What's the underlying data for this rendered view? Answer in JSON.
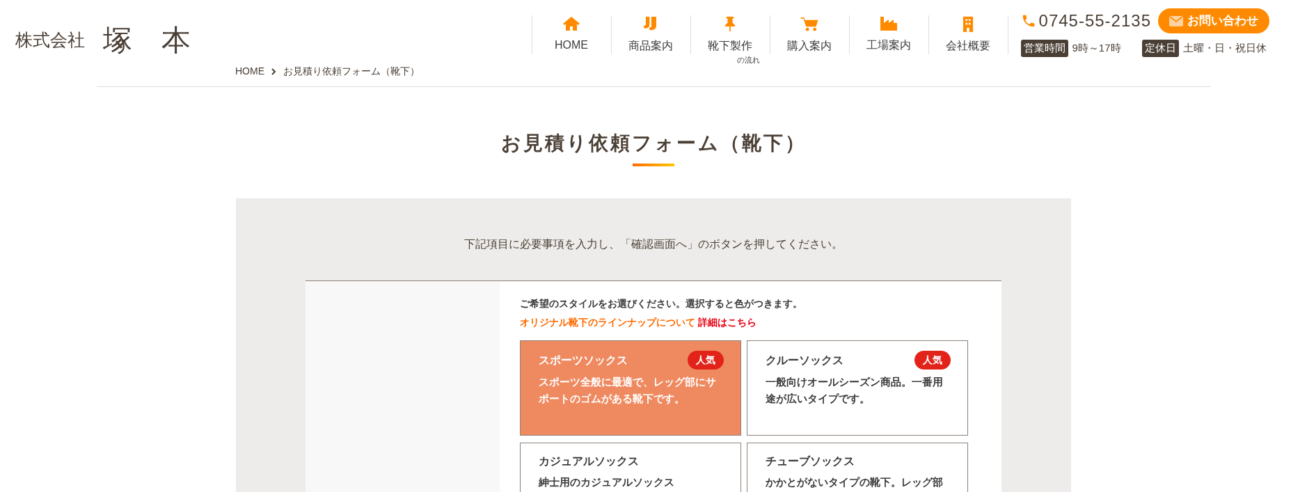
{
  "logo": {
    "company_type": "株式会社",
    "name": "塚　本"
  },
  "nav": [
    {
      "label": "HOME"
    },
    {
      "label": "商品案内"
    },
    {
      "label": "靴下製作",
      "sub": "の流れ"
    },
    {
      "label": "購入案内"
    },
    {
      "label": "工場案内"
    },
    {
      "label": "会社概要"
    }
  ],
  "contact": {
    "phone": "0745-55-2135",
    "button": "お問い合わせ",
    "hours_label": "営業時間",
    "hours": "9時～17時",
    "closed_label": "定休日",
    "closed": "土曜・日・祝日休"
  },
  "breadcrumb": [
    "HOME",
    "お見積り依頼フォーム（靴下）"
  ],
  "title": "お見積り依頼フォーム（靴下）",
  "intro": "下記項目に必要事項を入力し、「確認画面へ」のボタンを押してください。",
  "form": {
    "instruction": "ご希望のスタイルをお選びください。選択すると色がつきます。",
    "lineup_text": "オリジナル靴下のラインナップについて",
    "lineup_link": "詳細はこちら",
    "styles": [
      {
        "name": "スポーツソックス",
        "badge": "人気",
        "description": "スポーツ全般に最適で、レッグ部にサポートのゴムがある靴下です。",
        "selected": true
      },
      {
        "name": "クルーソックス",
        "badge": "人気",
        "description": "一般向けオールシーズン商品。一番用途が広いタイプです。",
        "selected": false
      },
      {
        "name": "カジュアルソックス",
        "description": "紳士用のカジュアルソックス",
        "selected": false
      },
      {
        "name": "チューブソックス",
        "description": "かかとがないタイプの靴下。レッグ部",
        "selected": false
      }
    ]
  }
}
